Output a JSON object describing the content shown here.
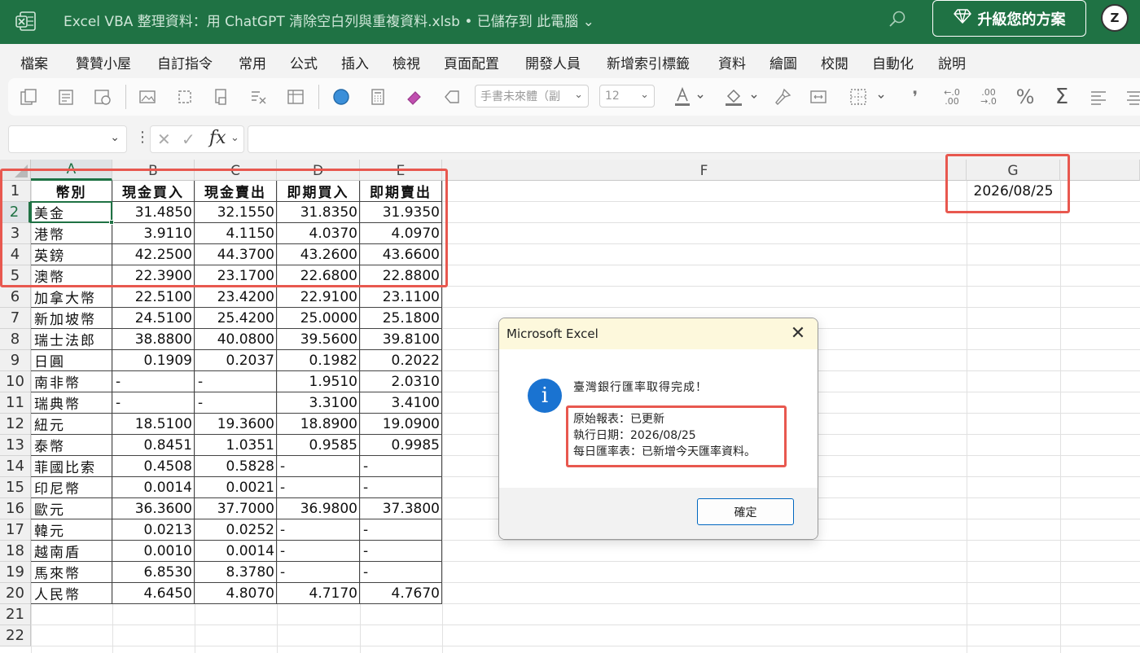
{
  "titlebar": {
    "title": "Excel VBA 整理資料：用 ChatGPT 清除空白列與重複資料.xlsb • 已儲存到 此電腦",
    "title_chevron": "⌄",
    "upgrade_label": "升級您的方案",
    "avatar_initial": "Z",
    "accent_color": "#1f7244"
  },
  "menu": [
    "檔案",
    "贊贊小屋",
    "自訂指令",
    "常用",
    "公式",
    "插入",
    "檢視",
    "頁面配置",
    "開發人員",
    "新增索引標籤",
    "資料",
    "繪圖",
    "校閱",
    "自動化",
    "說明"
  ],
  "ribbon": {
    "font_name": "手書未來體（副",
    "font_size": "12",
    "icons": [
      "copy-icon",
      "paste-icon",
      "paste-special-icon",
      "image-icon",
      "select-icon",
      "format-painter-icon",
      "clear-format-icon",
      "table-icon",
      "circle-icon",
      "calculator-icon",
      "eraser-icon",
      "shape-icon",
      "font-color-icon",
      "fill-color-icon",
      "brush-icon",
      "merge-icon",
      "border-icon",
      "comma-icon",
      "decrease-decimal-icon",
      "increase-decimal-icon",
      "percent-icon",
      "sum-icon",
      "align-left-icon",
      "align-center-icon"
    ],
    "comma_label": "❜",
    "decrease_decimal_label": "←.0\n.00",
    "increase_decimal_label": ".00\n→.0",
    "percent_label": "%",
    "sum_label": "Σ"
  },
  "formula_bar": {
    "name_box": "",
    "fx_label": "fx",
    "formula": ""
  },
  "grid": {
    "columns": [
      "A",
      "B",
      "C",
      "D",
      "E",
      "F",
      "G"
    ],
    "rows": [
      "1",
      "2",
      "3",
      "4",
      "5",
      "6",
      "7",
      "8",
      "9",
      "10",
      "11",
      "12",
      "13",
      "14",
      "15",
      "16",
      "17",
      "18",
      "19",
      "20",
      "21",
      "22"
    ],
    "headers": [
      "幣別",
      "現金買入",
      "現金賣出",
      "即期買入",
      "即期賣出"
    ],
    "data": [
      [
        "美金",
        "31.4850",
        "32.1550",
        "31.8350",
        "31.9350"
      ],
      [
        "港幣",
        "3.9110",
        "4.1150",
        "4.0370",
        "4.0970"
      ],
      [
        "英鎊",
        "42.2500",
        "44.3700",
        "43.2600",
        "43.6600"
      ],
      [
        "澳幣",
        "22.3900",
        "23.1700",
        "22.6800",
        "22.8800"
      ],
      [
        "加拿大幣",
        "22.5100",
        "23.4200",
        "22.9100",
        "23.1100"
      ],
      [
        "新加坡幣",
        "24.5100",
        "25.4200",
        "25.0000",
        "25.1800"
      ],
      [
        "瑞士法郎",
        "38.8800",
        "40.0800",
        "39.5600",
        "39.8100"
      ],
      [
        "日圓",
        "0.1909",
        "0.2037",
        "0.1982",
        "0.2022"
      ],
      [
        "南非幣",
        "-",
        "-",
        "1.9510",
        "2.0310"
      ],
      [
        "瑞典幣",
        "-",
        "-",
        "3.3100",
        "3.4100"
      ],
      [
        "紐元",
        "18.5100",
        "19.3600",
        "18.8900",
        "19.0900"
      ],
      [
        "泰幣",
        "0.8451",
        "1.0351",
        "0.9585",
        "0.9985"
      ],
      [
        "菲國比索",
        "0.4508",
        "0.5828",
        "-",
        "-"
      ],
      [
        "印尼幣",
        "0.0014",
        "0.0021",
        "-",
        "-"
      ],
      [
        "歐元",
        "36.3600",
        "37.7000",
        "36.9800",
        "37.3800"
      ],
      [
        "韓元",
        "0.0213",
        "0.0252",
        "-",
        "-"
      ],
      [
        "越南盾",
        "0.0010",
        "0.0014",
        "-",
        "-"
      ],
      [
        "馬來幣",
        "6.8530",
        "8.3780",
        "-",
        "-"
      ],
      [
        "人民幣",
        "4.6450",
        "4.8070",
        "4.7170",
        "4.7670"
      ]
    ],
    "g2": "2026/08/25",
    "active_cell": "A2"
  },
  "dialog": {
    "title": "Microsoft Excel",
    "close": "✕",
    "info_icon": "i",
    "message": "臺灣銀行匯率取得完成！",
    "line1": "原始報表：已更新",
    "line2": "執行日期：2026/08/25",
    "line3": "每日匯率表：已新增今天匯率資料。",
    "ok_label": "確定"
  },
  "colors": {
    "highlight_red": "#e8584f",
    "info_blue": "#1a73d1"
  }
}
